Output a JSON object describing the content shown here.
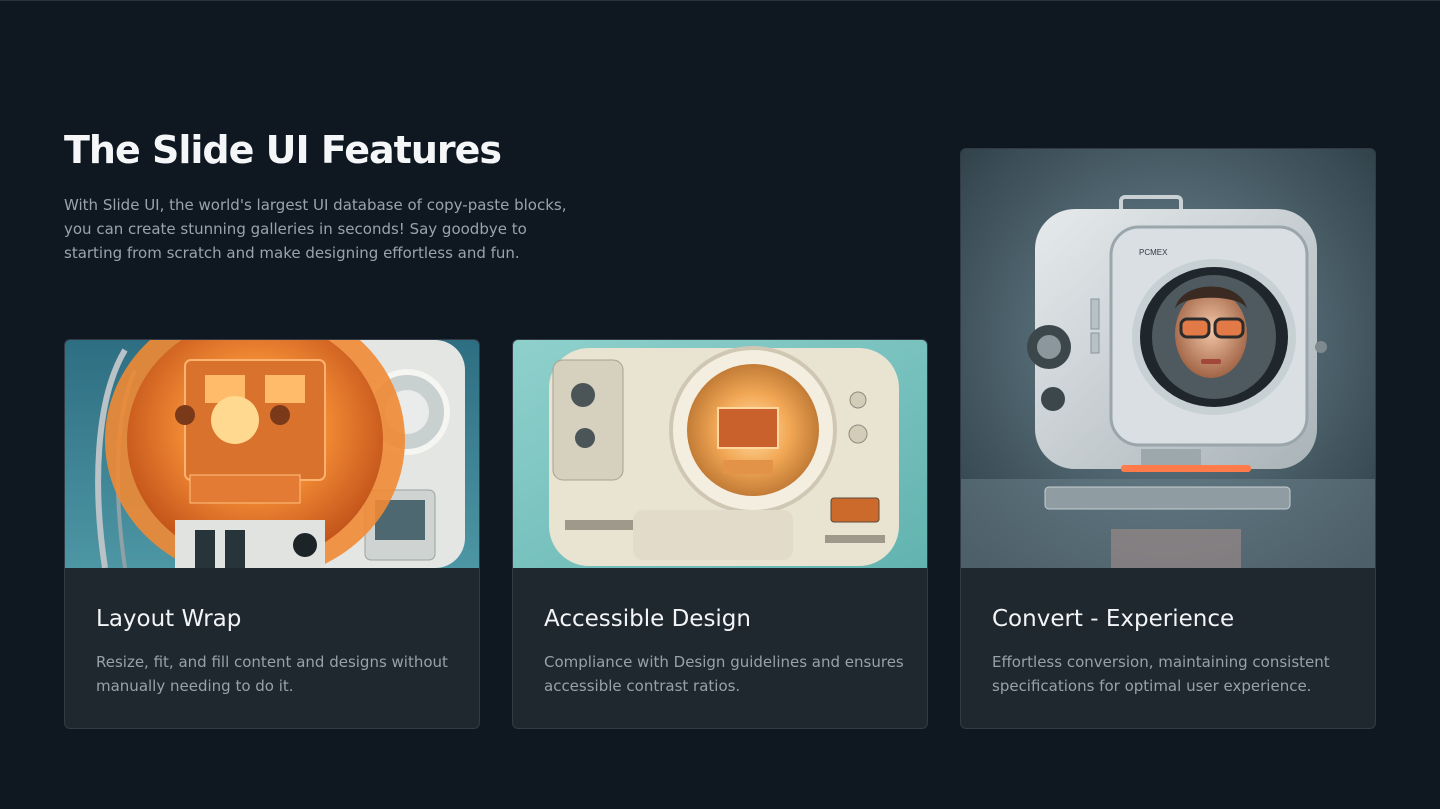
{
  "header": {
    "title": "The Slide UI Features",
    "description": "With Slide UI, the world's largest UI database of copy-paste blocks, you can create stunning galleries in seconds! Say goodbye to starting from scratch and make designing effortless and fun."
  },
  "cards": [
    {
      "title": "Layout Wrap",
      "description": "Resize, fit, and fill content and designs without manually needing to do it.",
      "image": "retro-orange-machine-illustration"
    },
    {
      "title": "Accessible Design",
      "description": "Compliance with Design guidelines and ensures accessible contrast ratios.",
      "image": "retro-cream-machine-illustration"
    },
    {
      "title": "Convert - Experience",
      "description": "Effortless conversion, maintaining consistent specifications for optimal user experience.",
      "image": "retro-tv-robot-face-illustration",
      "device_label": "PCMEX"
    }
  ],
  "colors": {
    "background": "#0f1720",
    "card_background": "#1f272f",
    "card_border": "#323b45",
    "heading": "#f4f6f8",
    "body_text": "#98a1aa"
  }
}
